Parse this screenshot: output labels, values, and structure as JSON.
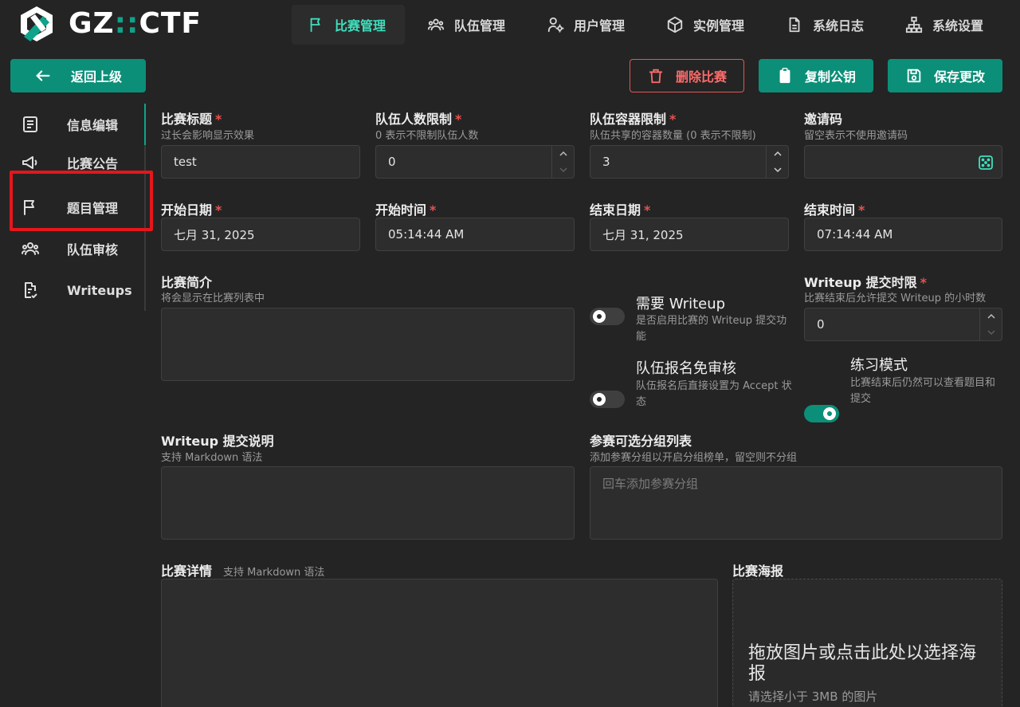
{
  "header": {
    "brand_prefix": "GZ",
    "brand_colons": "::",
    "brand_suffix": "CTF",
    "nav": [
      {
        "label": "比赛管理",
        "icon": "flag-icon",
        "active": true
      },
      {
        "label": "队伍管理",
        "icon": "users-icon"
      },
      {
        "label": "用户管理",
        "icon": "user-cog-icon"
      },
      {
        "label": "实例管理",
        "icon": "box-icon"
      },
      {
        "label": "系统日志",
        "icon": "file-text-icon"
      },
      {
        "label": "系统设置",
        "icon": "sitemap-icon"
      }
    ]
  },
  "toolbar": {
    "back_label": "返回上级",
    "delete_label": "删除比赛",
    "copy_key_label": "复制公钥",
    "save_label": "保存更改"
  },
  "sidebar": {
    "items": [
      {
        "label": "信息编辑",
        "icon": "file-text-icon",
        "active": true
      },
      {
        "label": "比赛公告",
        "icon": "megaphone-icon"
      },
      {
        "label": "题目管理",
        "icon": "flag-icon"
      },
      {
        "label": "队伍审核",
        "icon": "users-icon"
      },
      {
        "label": "Writeups",
        "icon": "file-check-icon"
      }
    ]
  },
  "form": {
    "title": {
      "label": "比赛标题",
      "desc": "过长会影响显示效果",
      "value": "test",
      "required": "*"
    },
    "team_size": {
      "label": "队伍人数限制",
      "desc": "0 表示不限制队伍人数",
      "value": "0",
      "required": "*"
    },
    "container_limit": {
      "label": "队伍容器限制",
      "desc": "队伍共享的容器数量 (0 表示不限制)",
      "value": "3",
      "required": "*"
    },
    "invite_code": {
      "label": "邀请码",
      "desc": "留空表示不使用邀请码",
      "value": ""
    },
    "start_date": {
      "label": "开始日期",
      "value": "七月 31, 2025",
      "required": "*"
    },
    "start_time": {
      "label": "开始时间",
      "value": "05:14:44 AM",
      "required": "*"
    },
    "end_date": {
      "label": "结束日期",
      "value": "七月 31, 2025",
      "required": "*"
    },
    "end_time": {
      "label": "结束时间",
      "value": "07:14:44 AM",
      "required": "*"
    },
    "summary": {
      "label": "比赛简介",
      "desc": "将会显示在比赛列表中",
      "value": ""
    },
    "writeup_required": {
      "title": "需要 Writeup",
      "desc": "是否启用比赛的 Writeup 提交功能",
      "on": false
    },
    "auto_accept": {
      "title": "队伍报名免审核",
      "desc": "队伍报名后直接设置为 Accept 状态",
      "on": false
    },
    "writeup_deadline": {
      "label": "Writeup 提交时限",
      "desc": "比赛结束后允许提交 Writeup 的小时数",
      "value": "0",
      "required": "*"
    },
    "practice_mode": {
      "title": "练习模式",
      "desc": "比赛结束后仍然可以查看题目和提交",
      "on": true
    },
    "writeup_note": {
      "label": "Writeup 提交说明",
      "desc": "支持 Markdown 语法",
      "value": ""
    },
    "divisions": {
      "label": "参赛可选分组列表",
      "desc": "添加参赛分组以开启分组榜单，留空则不分组",
      "placeholder": "回车添加参赛分组"
    },
    "details": {
      "label": "比赛详情",
      "desc": "支持 Markdown 语法",
      "value": ""
    },
    "poster": {
      "label": "比赛海报",
      "drop_text": "拖放图片或点击此处以选择海报",
      "hint": "请选择小于 3MB 的图片"
    }
  },
  "colors": {
    "accent": "#0c8f78",
    "accent_text": "#3ee0bd",
    "danger": "#e05757",
    "background": "#242424",
    "highlight_box": "#e5161c"
  }
}
